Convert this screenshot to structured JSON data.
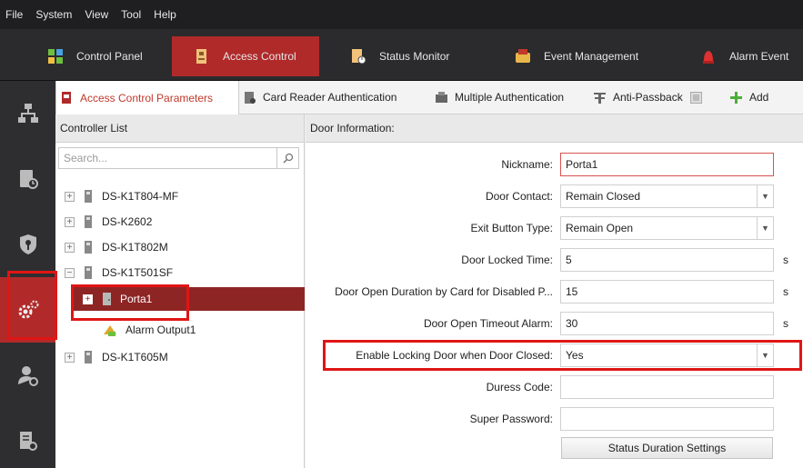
{
  "menu": [
    "File",
    "System",
    "View",
    "Tool",
    "Help"
  ],
  "modules": [
    {
      "label": "Control Panel",
      "icon": "control-panel-icon"
    },
    {
      "label": "Access Control",
      "icon": "access-control-icon"
    },
    {
      "label": "Status Monitor",
      "icon": "status-monitor-icon"
    },
    {
      "label": "Event Management",
      "icon": "event-management-icon"
    },
    {
      "label": "Alarm Event",
      "icon": "alarm-event-icon"
    }
  ],
  "subtabs": [
    {
      "label": "Access Control Parameters"
    },
    {
      "label": "Card Reader Authentication"
    },
    {
      "label": "Multiple Authentication"
    },
    {
      "label": "Anti-Passback"
    },
    {
      "label": "Add"
    }
  ],
  "left": {
    "title": "Controller List",
    "search_placeholder": "Search...",
    "tree": [
      {
        "label": "DS-K1T804-MF",
        "exp": "+"
      },
      {
        "label": "DS-K2602",
        "exp": "+"
      },
      {
        "label": "DS-K1T802M",
        "exp": "+"
      },
      {
        "label": "DS-K1T501SF",
        "exp": "−"
      },
      {
        "label": "Porta1",
        "exp": "+"
      },
      {
        "label": "Alarm Output1"
      },
      {
        "label": "DS-K1T605M",
        "exp": "+"
      }
    ]
  },
  "right": {
    "title": "Door Information:",
    "fields": [
      {
        "label": "Nickname:",
        "value": "Porta1"
      },
      {
        "label": "Door Contact:",
        "value": "Remain Closed"
      },
      {
        "label": "Exit Button Type:",
        "value": "Remain Open"
      },
      {
        "label": "Door Locked Time:",
        "value": "5",
        "unit": "s"
      },
      {
        "label": "Door Open Duration by Card for Disabled P...",
        "value": "15",
        "unit": "s"
      },
      {
        "label": "Door Open Timeout Alarm:",
        "value": "30",
        "unit": "s"
      },
      {
        "label": "Enable Locking Door when Door Closed:",
        "value": "Yes"
      },
      {
        "label": "Duress Code:",
        "value": ""
      },
      {
        "label": "Super Password:",
        "value": ""
      }
    ],
    "button": "Status Duration Settings"
  },
  "colors": {
    "accent": "#b02a2a",
    "highlight": "#e01515"
  }
}
